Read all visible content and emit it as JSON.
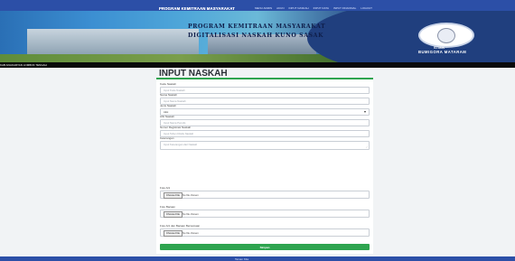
{
  "header": {
    "brand": "PROGRAM KEMITRAAN MASYARAKAT",
    "nav": [
      "MENU ADMIN",
      "AKUN",
      "INPUT NASKAH",
      "INPUT DATA",
      "INPUT FINANSIAL",
      "LOGOUT"
    ],
    "marquee": "Data Pemetaan Gerakan Wakaf Produktif Kabupaten Lombok Tengah"
  },
  "banner": {
    "title_line1": "PROGRAM KEMITRAAN MASYARAKAT",
    "title_line2": "DIGITALISASI NASKAH KUNO SASAK",
    "logo_caption1": "STMIK",
    "logo_caption2": "BUMIGORA MATARAM"
  },
  "newsbar": {
    "text": "KAB ANAKARYAN LOMBOK TENGAH"
  },
  "page_title": "INPUT NASKAH",
  "form": {
    "fields": [
      {
        "label": "Kode Naskah",
        "placeholder": "Input Kode Naskah",
        "type": "text"
      },
      {
        "label": "Nama Naskah",
        "placeholder": "Input Nama Naskah",
        "type": "text"
      },
      {
        "label": "Jenis Naskah",
        "value": "Aksi",
        "type": "select"
      },
      {
        "label": "Ahli Naskah",
        "placeholder": "Input Nama Penulis",
        "type": "text"
      },
      {
        "label": "Nomor Registrasi Naskah",
        "placeholder": "Input Tahun Ditulis Naskah",
        "type": "text"
      },
      {
        "label": "Keterangan",
        "placeholder": "Input Keterangan dari Naskah",
        "type": "textarea"
      }
    ],
    "files": [
      {
        "label": "Foto Arti",
        "button": "Choose File",
        "status": "No file chosen"
      },
      {
        "label": "Foto Bacaan",
        "button": "Choose File",
        "status": "No file chosen"
      },
      {
        "label": "Foto Arti dan Bacaan Bersamaan",
        "button": "Choose File",
        "status": "No file chosen"
      }
    ],
    "submit_label": "Simpan"
  },
  "footer": {
    "text": "Taman Kita"
  }
}
